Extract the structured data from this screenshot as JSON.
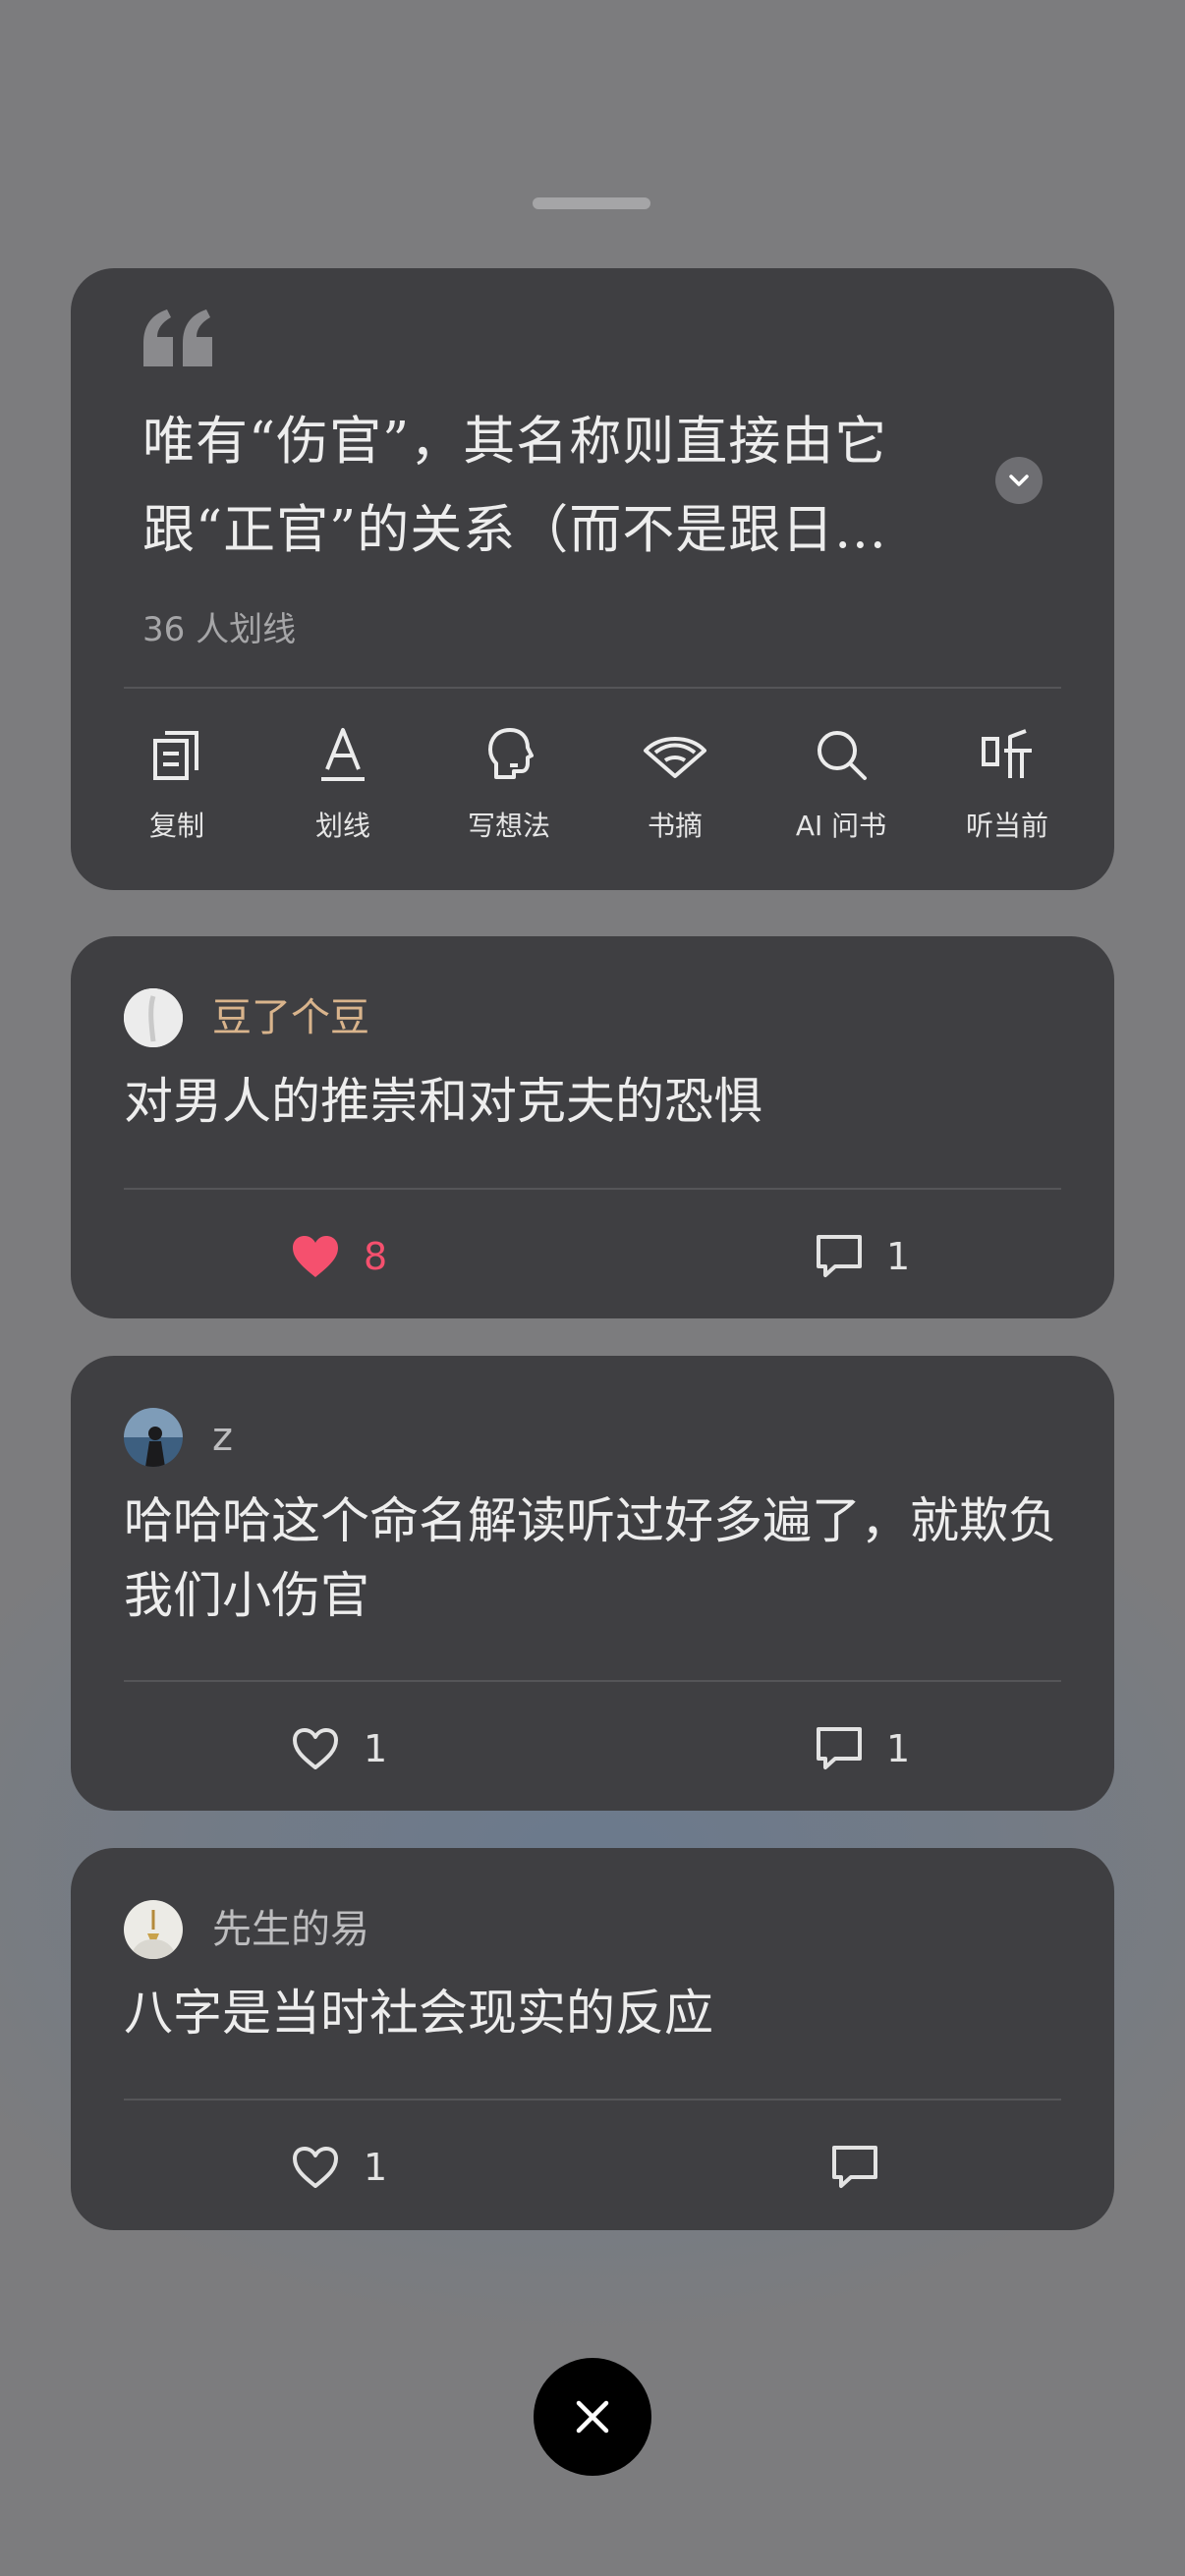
{
  "quote": {
    "text": "唯有“伤官”，其名称则直接由它跟“正官”的关系（而不是跟日...",
    "highlight_count": "36 人划线"
  },
  "actions": [
    {
      "label": "复制",
      "icon": "copy-icon"
    },
    {
      "label": "划线",
      "icon": "underline-icon"
    },
    {
      "label": "写想法",
      "icon": "thought-icon"
    },
    {
      "label": "书摘",
      "icon": "book-excerpt-icon"
    },
    {
      "label": "AI 问书",
      "icon": "search-icon"
    },
    {
      "label": "听当前",
      "icon": "listen-icon"
    }
  ],
  "comments": [
    {
      "author": "豆了个豆",
      "author_color": "#d9b48c",
      "text": "对男人的推崇和对克夫的恐惧",
      "likes": "8",
      "liked": true,
      "replies": "1"
    },
    {
      "author": "z",
      "author_color": "#bdbdbf",
      "text": "哈哈哈这个命名解读听过好多遍了，就欺负我们小伤官",
      "likes": "1",
      "liked": false,
      "replies": "1"
    },
    {
      "author": "先生的易",
      "author_color": "#bdbdbf",
      "text": "八字是当时社会现实的反应",
      "likes": "1",
      "liked": false,
      "replies": ""
    }
  ],
  "colors": {
    "liked": "#f5506e",
    "card": "#3f3f42",
    "backdrop": "#7c7c7e"
  }
}
